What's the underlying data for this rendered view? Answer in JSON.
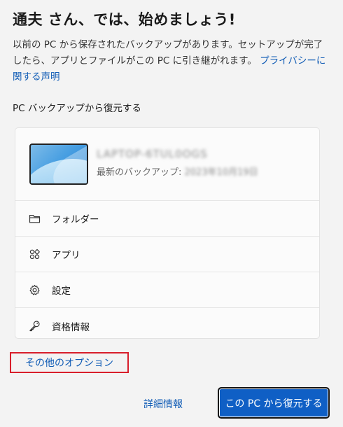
{
  "header": {
    "title": "通夫 さん、では、始めましょう!"
  },
  "intro": {
    "text": "以前の PC から保存されたバックアップがあります。セットアップが完了したら、アプリとファイルがこの PC に引き継がれます。 ",
    "privacy_link": "プライバシーに関する声明"
  },
  "section": {
    "label": "PC バックアップから復元する"
  },
  "device": {
    "name": "LAPTOP-6TUL0OGS",
    "backup_label": "最新のバックアップ: ",
    "backup_date": "2023年10月19日"
  },
  "items": [
    {
      "label": "フォルダー",
      "icon": "folder-icon"
    },
    {
      "label": "アプリ",
      "icon": "apps-icon"
    },
    {
      "label": "設定",
      "icon": "gear-icon"
    },
    {
      "label": "資格情報",
      "icon": "key-icon"
    }
  ],
  "footer": {
    "more_options": "その他のオプション",
    "details": "詳細情報",
    "restore_button": "この PC から復元する"
  },
  "colors": {
    "accent": "#0f5fc5",
    "link": "#0f5bb5",
    "highlight_box": "#d81e2b"
  }
}
